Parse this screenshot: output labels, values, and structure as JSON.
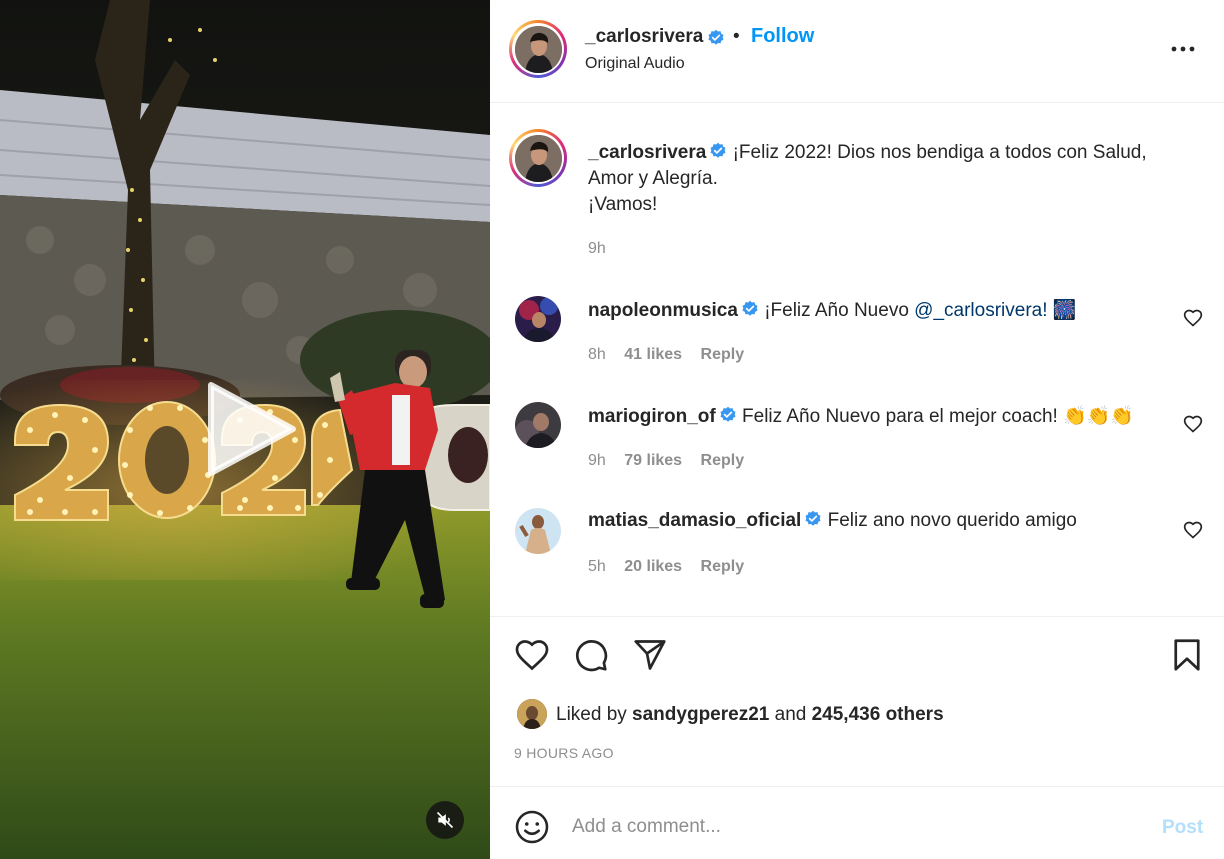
{
  "post": {
    "author": "_carlosrivera",
    "follow_label": "Follow",
    "dot": "•",
    "audio_label": "Original Audio",
    "caption_lines": [
      "¡Feliz 2022! Dios nos bendiga a todos con Salud,",
      "Amor y Alegría.",
      "¡Vamos!"
    ],
    "caption_time": "9h"
  },
  "comments": [
    {
      "username": "napoleonmusica",
      "text": "¡Feliz Año Nuevo ",
      "mention": "@_carlosrivera!",
      "suffix": " 🎆",
      "time": "8h",
      "likes": "41 likes",
      "reply": "Reply"
    },
    {
      "username": "mariogiron_of",
      "text": "Feliz Año Nuevo para el mejor coach! 👏👏👏",
      "mention": "",
      "suffix": "",
      "time": "9h",
      "likes": "79 likes",
      "reply": "Reply"
    },
    {
      "username": "matias_damasio_oficial",
      "text": "Feliz ano novo querido amigo",
      "mention": "",
      "suffix": "",
      "time": "5h",
      "likes": "20 likes",
      "reply": "Reply"
    }
  ],
  "likes": {
    "prefix": "Liked by ",
    "user": "sandygperez21",
    "middle": " and ",
    "others": "245,436 others"
  },
  "timestamp": "9 HOURS AGO",
  "composer": {
    "placeholder": "Add a comment...",
    "post_label": "Post"
  },
  "icons": {
    "more": "more-options-icon",
    "heart": "heart-icon",
    "comment": "comment-icon",
    "share": "share-icon",
    "save": "bookmark-icon",
    "emoji": "emoji-icon",
    "play": "play-icon",
    "mute": "muted-icon",
    "verified": "verified-badge-icon"
  },
  "colors": {
    "accent": "#0095f6",
    "verified": "#3897f0",
    "text": "#262626",
    "secondary": "#8e8e8e",
    "post_disabled": "#b2dffc"
  }
}
